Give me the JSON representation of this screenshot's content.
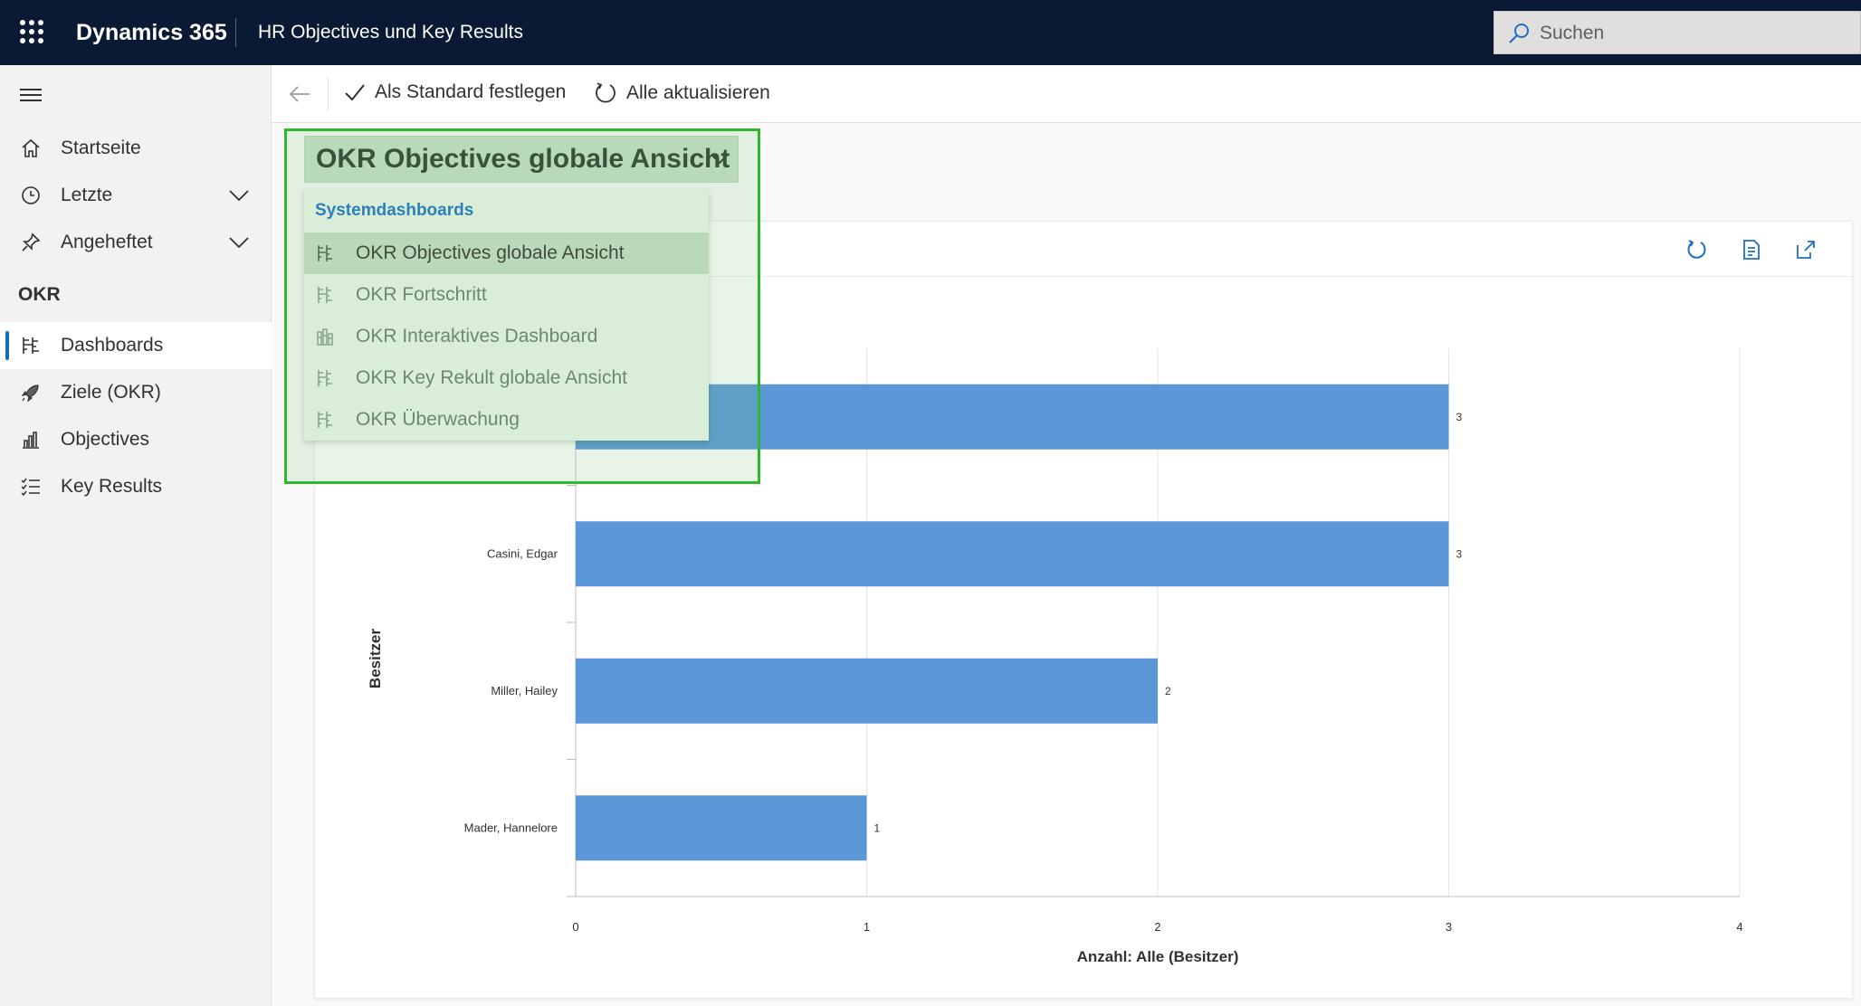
{
  "topbar": {
    "brand": "Dynamics 365",
    "app_title": "HR Objectives und Key Results",
    "search_placeholder": "Suchen"
  },
  "sidebar": {
    "items": [
      {
        "label": "Startseite",
        "icon": "home-icon"
      },
      {
        "label": "Letzte",
        "icon": "clock-icon",
        "expandable": true
      },
      {
        "label": "Angeheftet",
        "icon": "pin-icon",
        "expandable": true
      }
    ],
    "section_title": "OKR",
    "section_items": [
      {
        "label": "Dashboards",
        "icon": "dashboard-icon",
        "active": true
      },
      {
        "label": "Ziele (OKR)",
        "icon": "rocket-icon"
      },
      {
        "label": "Objectives",
        "icon": "bar-chart-icon"
      },
      {
        "label": "Key Results",
        "icon": "checklist-icon"
      }
    ]
  },
  "commandbar": {
    "set_default": "Als Standard festlegen",
    "refresh_all": "Alle aktualisieren"
  },
  "dashboard": {
    "selected": "OKR Objectives globale Ansicht"
  },
  "dropdown": {
    "header": "Systemdashboards",
    "items": [
      {
        "label": "OKR Objectives globale Ansicht",
        "selected": true
      },
      {
        "label": "OKR Fortschritt"
      },
      {
        "label": "OKR Interaktives Dashboard"
      },
      {
        "label": "OKR Key Rekult globale Ansicht"
      },
      {
        "label": "OKR Überwachung"
      }
    ]
  },
  "colors": {
    "topbar": "#0b1a34",
    "bar": "#5b97d6",
    "highlight": "#2fb72f",
    "accent": "#0f6cbd"
  },
  "chart_data": {
    "type": "bar",
    "orientation": "horizontal",
    "categories": [
      "",
      "Casini, Edgar",
      "Miller, Hailey",
      "Mader, Hannelore"
    ],
    "values": [
      3,
      3,
      2,
      1
    ],
    "xlabel": "Anzahl: Alle (Besitzer)",
    "ylabel": "Besitzer",
    "xlim": [
      0,
      4
    ],
    "x_ticks": [
      "0",
      "1",
      "2",
      "3",
      "4"
    ],
    "grid": true
  }
}
